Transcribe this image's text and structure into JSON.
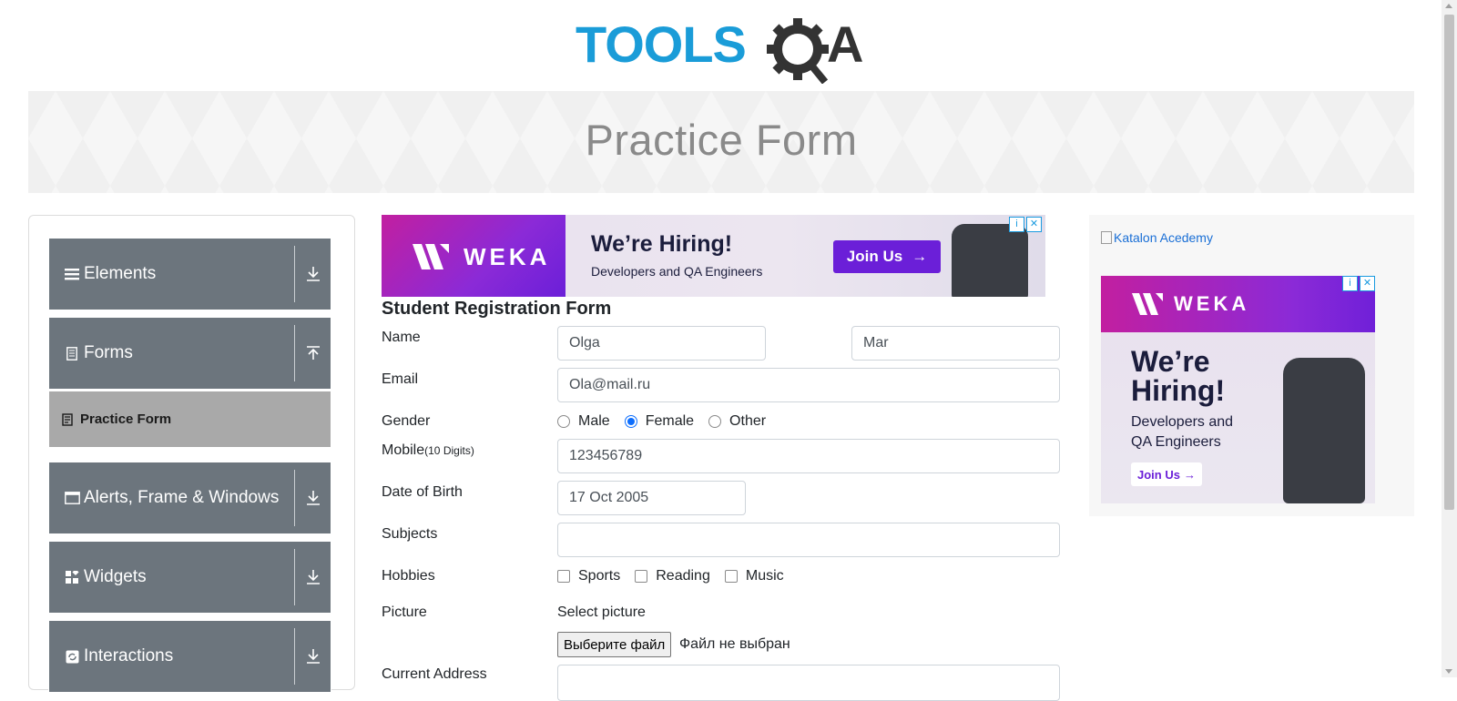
{
  "logo": {
    "text_left": "TOOLS",
    "text_right": "QA"
  },
  "banner": {
    "title": "Practice Form"
  },
  "sidebar": {
    "groups": [
      {
        "label": "Elements",
        "icon": "list-icon",
        "arrow": "download-arrow-icon"
      },
      {
        "label": "Forms",
        "icon": "document-icon",
        "arrow": "upload-arrow-icon"
      },
      {
        "label": "Alerts, Frame & Windows",
        "icon": "window-icon",
        "arrow": "download-arrow-icon"
      },
      {
        "label": "Widgets",
        "icon": "widgets-icon",
        "arrow": "download-arrow-icon"
      },
      {
        "label": "Interactions",
        "icon": "refresh-icon",
        "arrow": "download-arrow-icon"
      }
    ],
    "active_item": {
      "label": "Practice Form",
      "icon": "form-icon"
    }
  },
  "ad_top": {
    "brand": "WEKA",
    "headline": "We’re Hiring!",
    "subline": "Developers and QA Engineers",
    "cta": "Join Us"
  },
  "form": {
    "title": "Student Registration Form",
    "name_label": "Name",
    "first_name": "Olga",
    "last_name": "Mar",
    "email_label": "Email",
    "email": "Ola@mail.ru",
    "gender_label": "Gender",
    "gender_options": [
      "Male",
      "Female",
      "Other"
    ],
    "gender_selected": "Female",
    "mobile_label": "Mobile",
    "mobile_hint": "(10 Digits)",
    "mobile": "123456789",
    "dob_label": "Date of Birth",
    "dob": "17 Oct 2005",
    "subjects_label": "Subjects",
    "subjects": "",
    "hobbies_label": "Hobbies",
    "hobbies": [
      "Sports",
      "Reading",
      "Music"
    ],
    "picture_label": "Picture",
    "picture_select": "Select picture",
    "file_button": "Выберите файл",
    "file_status": "Файл не выбран",
    "address_label": "Current Address"
  },
  "ad_right": {
    "alt_link": "Katalon Acedemy",
    "brand": "WEKA",
    "headline_1": "We’re",
    "headline_2": "Hiring!",
    "sub_1": "Developers and",
    "sub_2": "QA Engineers",
    "cta": "Join Us"
  },
  "colors": {
    "sidebar_group": "#6c757d",
    "sidebar_active": "#a9a9a9",
    "radio_selected": "#0d6efd",
    "logo_blue": "#1a9cd8",
    "logo_dark": "#333333"
  }
}
